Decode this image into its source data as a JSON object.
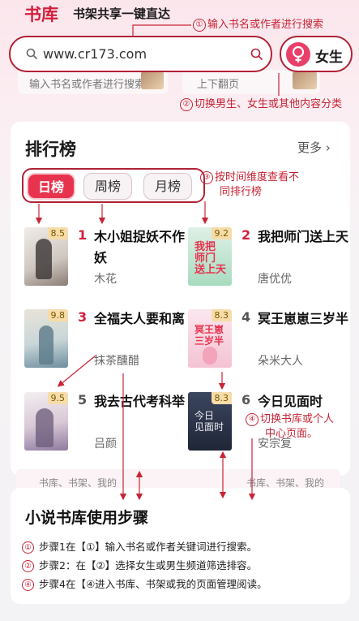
{
  "header": {
    "app_title": "书库",
    "slogan": "书架共享一键直达"
  },
  "search": {
    "value": "www.cr173.com"
  },
  "gender_toggle": {
    "label": "女生",
    "accent": "#e8406a"
  },
  "background_cards": {
    "left_text": "输入书名或作者进行搜索",
    "right_text": "上下翻页"
  },
  "annotations": {
    "a1_num": "①",
    "a1_text": "输入书名或作者进行搜索",
    "a2_num": "②",
    "a2_text": "切换男生、女生或其他内容分类",
    "a3_num": "③",
    "a3_line1": "按时间维度查看不",
    "a3_line2": "同排行榜",
    "a4_num": "④",
    "a4_line1": "切换书库或个人",
    "a4_line2": "中心页面。"
  },
  "ranking": {
    "title": "排行榜",
    "more": "更多",
    "tabs": [
      {
        "label": "日榜",
        "active": true
      },
      {
        "label": "周榜",
        "active": false
      },
      {
        "label": "月榜",
        "active": false
      }
    ],
    "books": [
      {
        "rank": "1",
        "title": "木小姐捉妖不作妖",
        "author": "木花",
        "score": "8.5"
      },
      {
        "rank": "2",
        "title": "我把师门送上天",
        "author": "唐优优",
        "score": "9.2"
      },
      {
        "rank": "3",
        "title": "全福夫人要和离",
        "author": "抹茶醺醋",
        "score": "9.8"
      },
      {
        "rank": "4",
        "title": "冥王崽崽三岁半",
        "author": "朵米大人",
        "score": "8.3"
      },
      {
        "rank": "5",
        "title": "我去古代考科举",
        "author": "吕颜",
        "score": "9.5"
      },
      {
        "rank": "6",
        "title": "今日见面时",
        "author": "安宗复",
        "score": "8.3"
      }
    ]
  },
  "bottom_ghost": {
    "left": "书库、书架、我的",
    "right": "书库、书架、我的"
  },
  "steps": {
    "title": "小说书库使用步骤",
    "items": [
      {
        "num": "①",
        "text": "步骤1在【①】输入书名或作者关键词进行搜索。"
      },
      {
        "num": "②",
        "text": "步骤2：在【②】选择女生或男生频道筛选排容。"
      },
      {
        "num": "④",
        "text": "步骤4在【④进入书库、书架或我的页面管理阅读。"
      }
    ]
  },
  "colors": {
    "brand_red": "#d21f3c",
    "annotation_red": "#c72436",
    "tab_active": "#e8334e",
    "score_badge": "#f6dca8"
  }
}
